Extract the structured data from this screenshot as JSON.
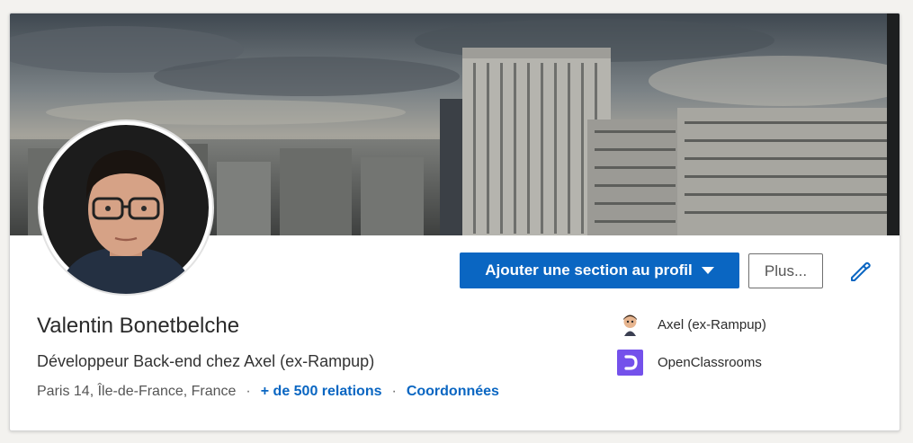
{
  "profile": {
    "name": "Valentin Bonetbelche",
    "headline": "Développeur Back-end chez Axel (ex-Rampup)",
    "location": "Paris 14, Île-de-France, France",
    "separator": "·",
    "connections": "+ de 500 relations",
    "contact": "Coordonnées"
  },
  "actions": {
    "add_section": "Ajouter une section au profil",
    "more": "Plus..."
  },
  "organizations": [
    {
      "name": "Axel (ex-Rampup)",
      "icon": "axel-logo-icon"
    },
    {
      "name": "OpenClassrooms",
      "icon": "openclassrooms-logo-icon",
      "color": "#7451eb"
    }
  ],
  "colors": {
    "accent": "#0a66c2",
    "page_background": "#f3f2ef"
  }
}
